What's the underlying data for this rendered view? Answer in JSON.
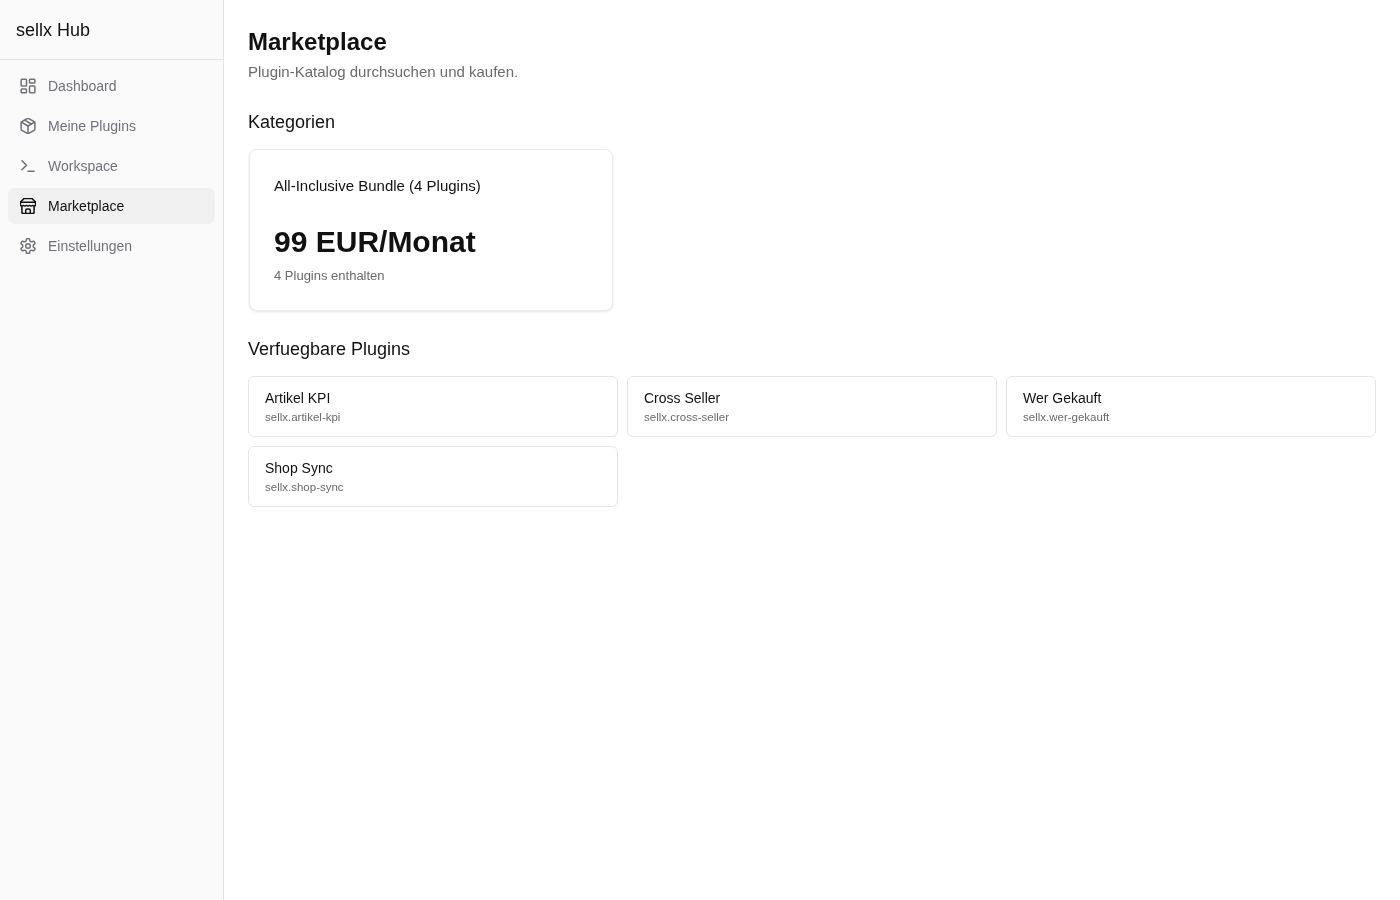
{
  "sidebar": {
    "title": "sellx Hub",
    "items": [
      {
        "label": "Dashboard",
        "kind": "dashboard",
        "selected": false
      },
      {
        "label": "Meine Plugins",
        "kind": "plugins",
        "selected": false
      },
      {
        "label": "Workspace",
        "kind": "workspace",
        "selected": false
      },
      {
        "label": "Marketplace",
        "kind": "marketplace",
        "selected": true
      },
      {
        "label": "Einstellungen",
        "kind": "settings",
        "selected": false
      }
    ]
  },
  "page": {
    "title": "Marketplace",
    "subtitle": "Plugin-Katalog durchsuchen und kaufen."
  },
  "categories": {
    "heading": "Kategorien",
    "bundles": [
      {
        "name": "All-Inclusive Bundle (4 Plugins)",
        "price": "99 EUR/Monat",
        "note": "4 Plugins enthalten"
      }
    ]
  },
  "plugins": {
    "heading": "Verfuegbare Plugins",
    "items": [
      {
        "name": "Artikel KPI",
        "id": "sellx.artikel-kpi"
      },
      {
        "name": "Cross Seller",
        "id": "sellx.cross-seller"
      },
      {
        "name": "Wer Gekauft",
        "id": "sellx.wer-gekauft"
      },
      {
        "name": "Shop Sync",
        "id": "sellx.shop-sync"
      }
    ]
  }
}
